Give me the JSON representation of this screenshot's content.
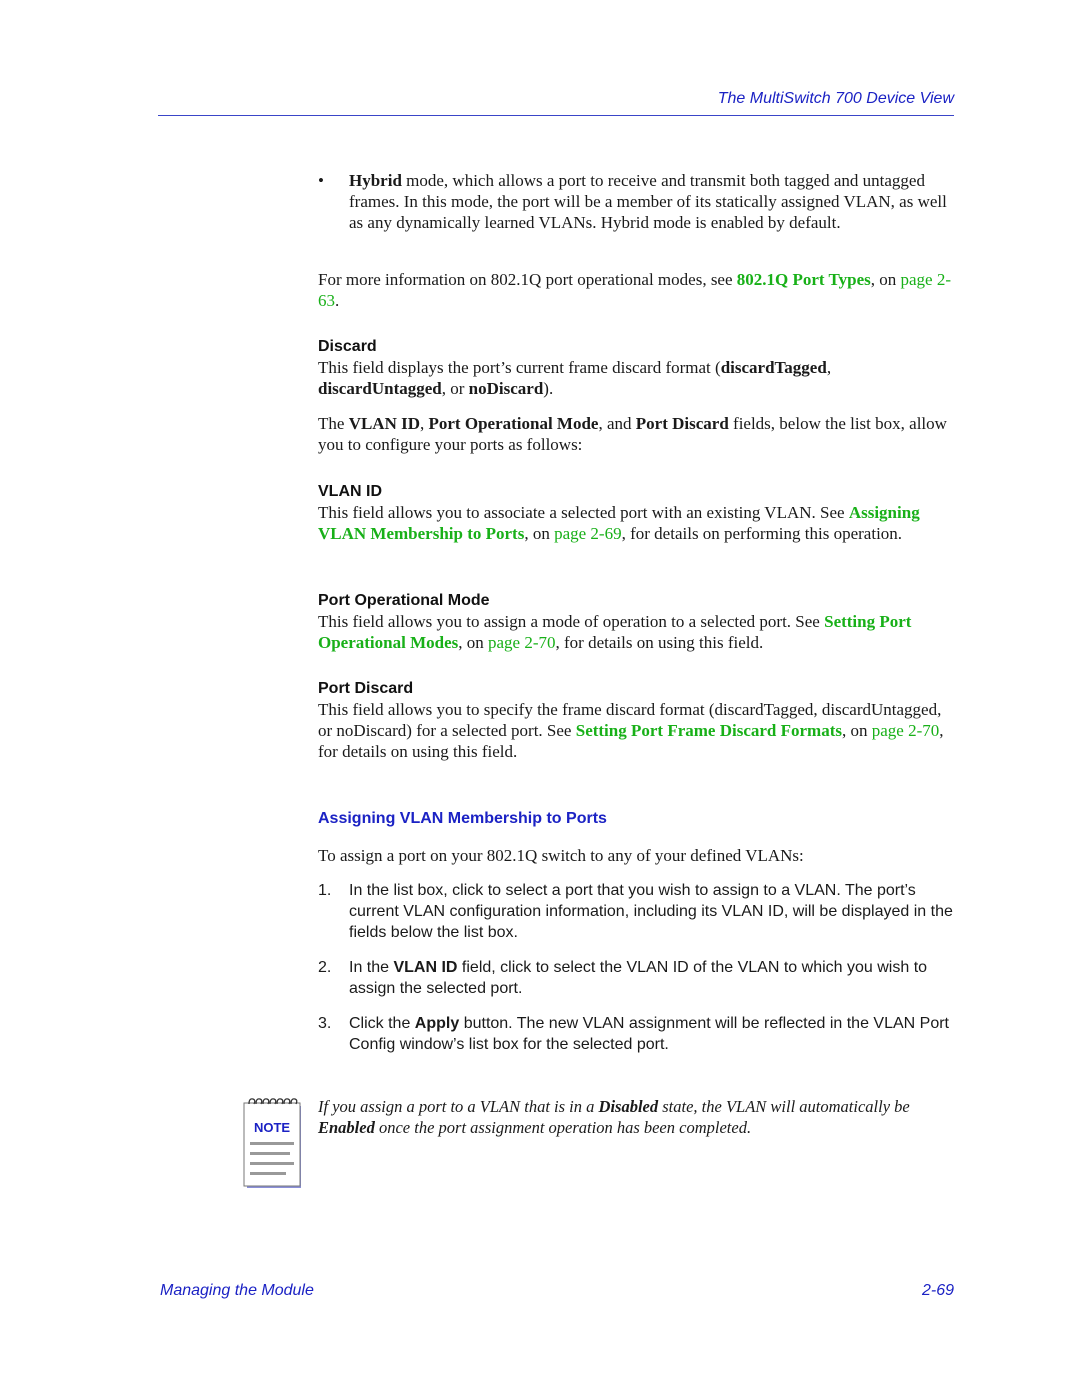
{
  "header": {
    "title": "The MultiSwitch 700 Device View"
  },
  "bullet": {
    "symbol": "•",
    "term": "Hybrid",
    "text": " mode, which allows a port to receive and transmit both tagged and untagged frames. In this mode, the port will be a member of its statically assigned VLAN, as well as any dynamically learned VLANs. Hybrid mode is enabled by default."
  },
  "more_info": {
    "prefix": "For more information on 802.1Q port operational modes, see ",
    "link": "802.1Q Port Types",
    "mid": ", on ",
    "page_link": "page 2-63",
    "suffix": "."
  },
  "discard": {
    "heading": "Discard",
    "p1": "This field displays the port’s current frame discard format (",
    "b1": "discardTagged",
    "p2": ", ",
    "b2": "discardUntagged",
    "p3": ", or ",
    "b3": "noDiscard",
    "p4": ")."
  },
  "fields_intro": {
    "p1": "The ",
    "b1": "VLAN ID",
    "p2": ", ",
    "b2": "Port Operational Mode",
    "p3": ", and ",
    "b3": "Port Discard",
    "p4": " fields, below the list box, allow you to configure your ports as follows:"
  },
  "vlan_id": {
    "heading": "VLAN ID",
    "p1": "This field allows you to associate a selected port with an existing VLAN. See ",
    "link": "Assigning VLAN Membership to Ports",
    "p2": ", on ",
    "page_link": "page 2-69",
    "p3": ", for details on performing this operation."
  },
  "port_mode": {
    "heading": "Port Operational Mode",
    "p1": "This field allows you to assign a mode of operation to a selected port. See ",
    "link": "Setting Port Operational Modes",
    "p2": ", on ",
    "page_link": "page 2-70",
    "p3": ", for details on using this field."
  },
  "port_discard": {
    "heading": "Port Discard",
    "p1": "This field allows you to specify the frame discard format (discardTagged, discardUntagged, or noDiscard) for a selected port. See ",
    "link": "Setting Port Frame Discard Formats",
    "p2": ", on ",
    "page_link": "page 2-70",
    "p3": ", for details on using this field."
  },
  "section": {
    "heading": "Assigning VLAN Membership to Ports",
    "intro": "To assign a port on your 802.1Q switch to any of your defined VLANs:"
  },
  "steps": [
    {
      "num": "1.",
      "p1": "In the list box, click to select a port that you wish to assign to a VLAN. The port’s current VLAN configuration information, including its VLAN ID, will be displayed in the fields below the list box."
    },
    {
      "num": "2.",
      "p1": "In the ",
      "b1": "VLAN ID",
      "p2": " field, click to select the VLAN ID of the VLAN to which you wish to assign the selected port."
    },
    {
      "num": "3.",
      "p1": "Click the ",
      "b1": "Apply",
      "p2": " button. The new VLAN assignment will be reflected in the VLAN Port Config window’s list box for the selected port."
    }
  ],
  "note": {
    "icon_label": "NOTE",
    "p1": "If you assign a port to a VLAN that is in a ",
    "b1": "Disabled",
    "p2": " state, the VLAN will automatically be ",
    "b2": "Enabled",
    "p3": " once the port assignment operation has been completed."
  },
  "footer": {
    "left": "Managing the Module",
    "right": "2-69"
  },
  "colors": {
    "header_blue": "#1b22c4",
    "link_green": "#18b018"
  }
}
